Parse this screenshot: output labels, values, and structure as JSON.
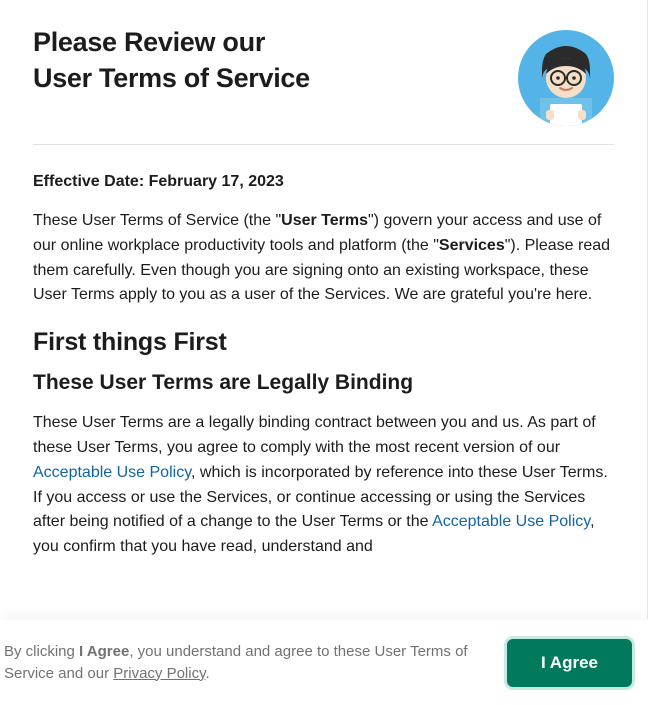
{
  "header": {
    "title_line1": "Please Review our",
    "title_line2": "User Terms of Service"
  },
  "effective": {
    "label": "Effective Date:",
    "date": "February 17, 2023"
  },
  "intro": {
    "pre1": "These User Terms of Service (the \"",
    "bold1": "User Terms",
    "mid1": "\") govern your access and use of our online workplace productivity tools and platform (the \"",
    "bold2": "Services",
    "post1": "\"). Please read them carefully. Even though you are signing onto an existing workspace, these User Terms apply to you as a user of the Services. We are grateful you're here."
  },
  "section1": {
    "heading": "First things First",
    "subheading": "These User Terms are Legally Binding",
    "p1_pre": "These User Terms are a legally binding contract between you and us. As part of these User Terms, you agree to comply with the most recent version of our ",
    "p1_link1": "Acceptable Use Policy",
    "p1_mid": ", which is incorporated by reference into these User Terms. If you access or use the Services, or continue accessing or using the Services after being notified of a change to the User Terms or the ",
    "p1_link2": "Acceptable Use Policy",
    "p1_post": ", you confirm that you have read, understand and"
  },
  "footer": {
    "pre": "By clicking ",
    "bold": "I Agree",
    "mid": ", you understand and agree to these User Terms of Service and our ",
    "pp": "Privacy Policy",
    "post": ".",
    "button": "I Agree"
  }
}
